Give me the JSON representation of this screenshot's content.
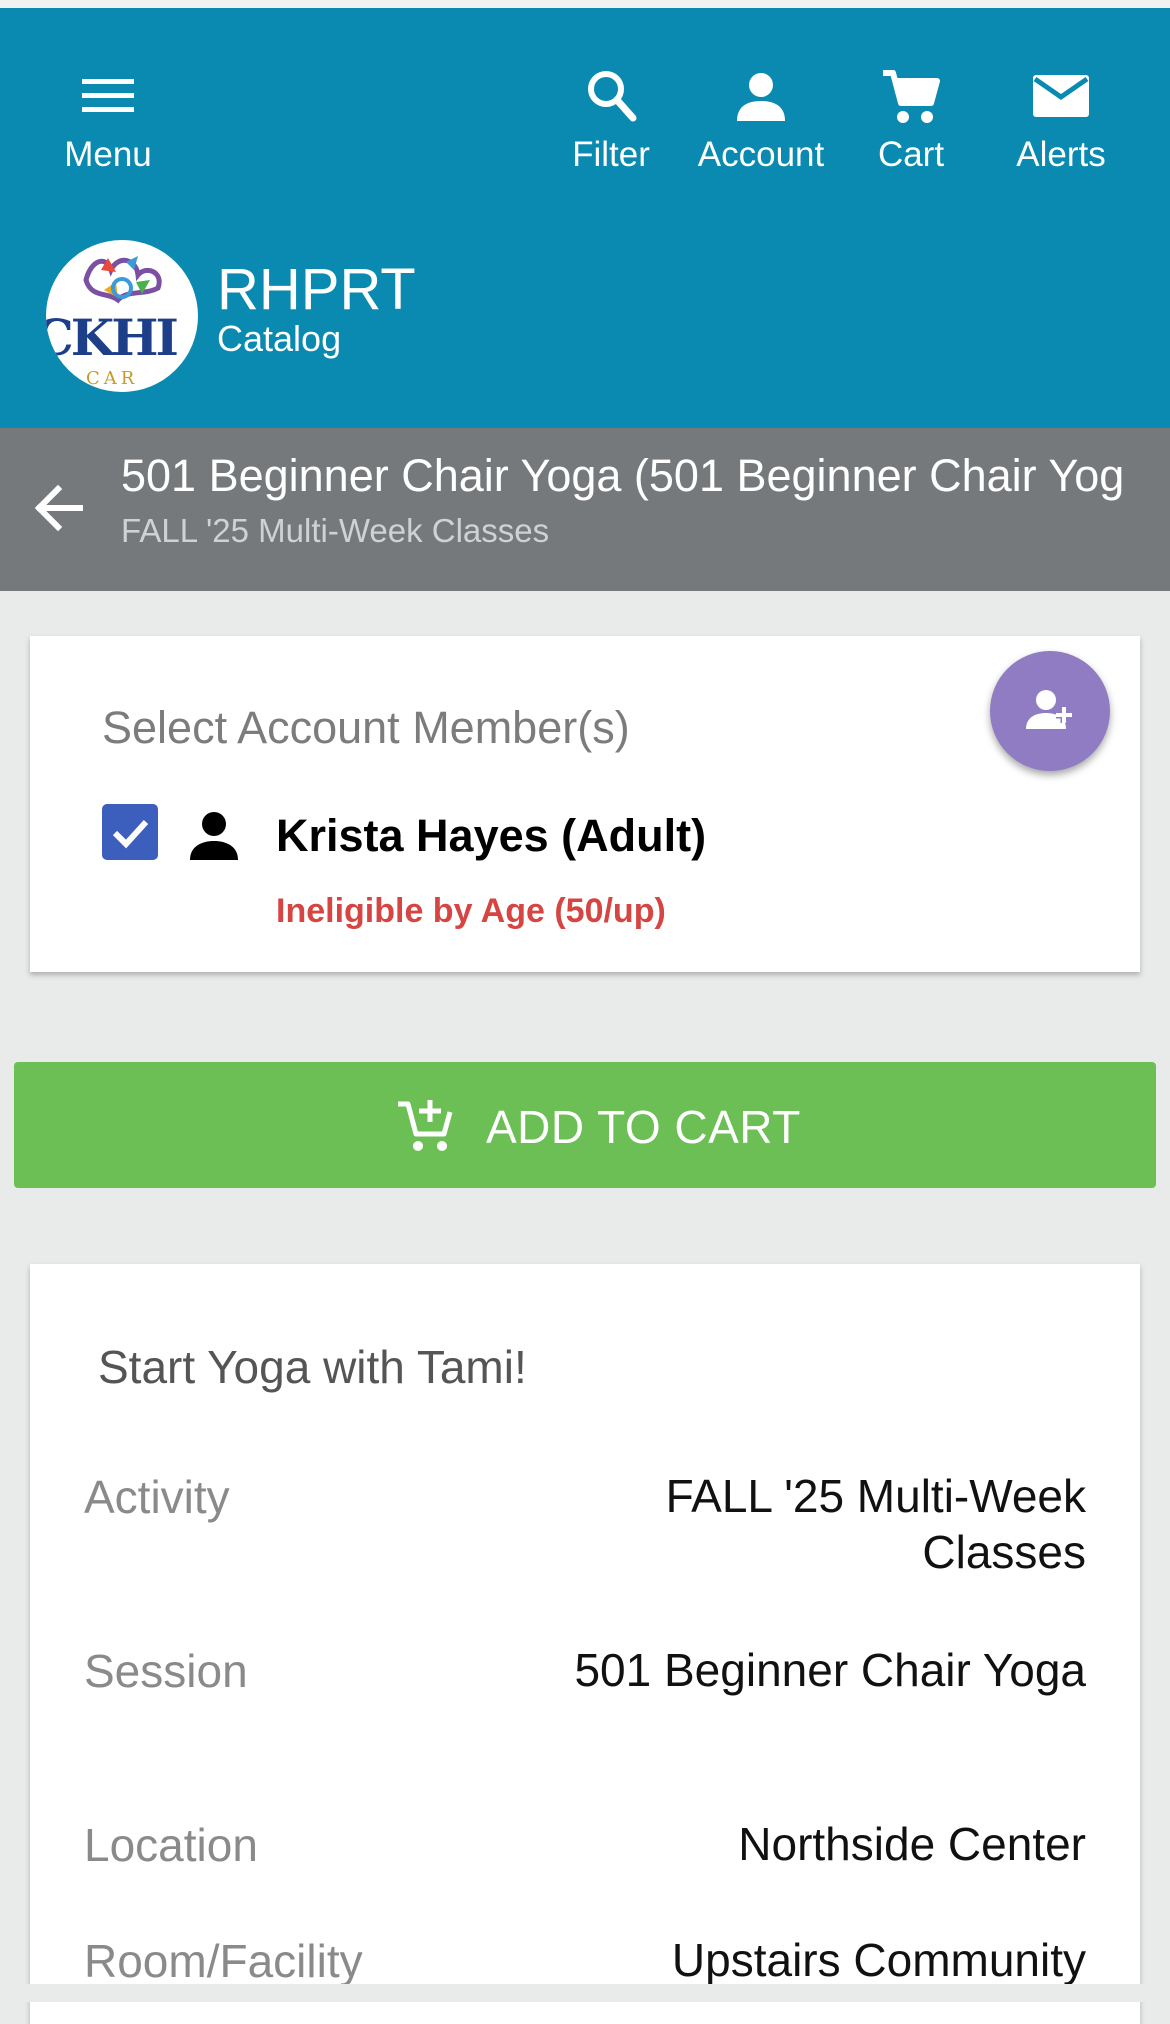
{
  "nav": {
    "menu": "Menu",
    "filter": "Filter",
    "account": "Account",
    "cart": "Cart",
    "alerts": "Alerts"
  },
  "brand": {
    "logo_text": "CKHI",
    "logo_sub": "CAR",
    "name": "RHPRT",
    "section": "Catalog"
  },
  "page": {
    "title": "501 Beginner Chair Yoga (501 Beginner Chair Yog",
    "subtitle": "FALL '25 Multi-Week Classes"
  },
  "members": {
    "label": "Select Account Member(s)",
    "items": [
      {
        "name": "Krista Hayes (Adult)",
        "checked": true,
        "warning": "Ineligible by Age (50/up)"
      }
    ]
  },
  "add_to_cart": "ADD TO CART",
  "details": {
    "description": "Start Yoga with Tami!",
    "rows": [
      {
        "label": "Activity",
        "value": "FALL '25 Multi-Week Classes"
      },
      {
        "label": "Session",
        "value": "501 Beginner Chair Yoga"
      },
      {
        "label": "Location",
        "value": "Northside Center"
      },
      {
        "label": "Room/Facility",
        "value": "Upstairs Community"
      }
    ]
  },
  "colors": {
    "header": "#0a8ab0",
    "subheader": "#76797c",
    "add_to_cart": "#6cbf54",
    "fab": "#8f7cc3",
    "checkbox": "#3c5fbd",
    "warning": "#d64541"
  },
  "icons": [
    "menu-icon",
    "search-icon",
    "account-icon",
    "cart-icon",
    "mail-icon",
    "back-arrow-icon",
    "add-person-icon",
    "check-icon",
    "person-icon",
    "add-cart-icon"
  ]
}
